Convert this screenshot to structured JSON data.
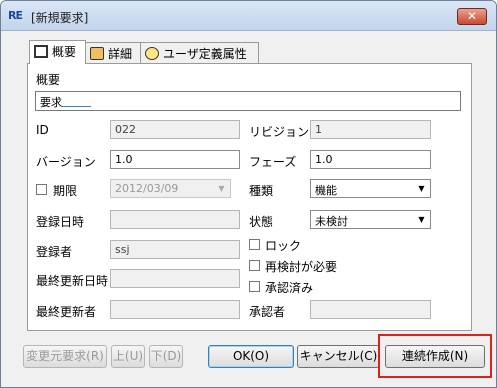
{
  "window": {
    "app_icon_text": "RE",
    "title": "[新規要求]",
    "close_glyph": "✕"
  },
  "tabs": [
    {
      "label": "概要",
      "icon": "summary-icon"
    },
    {
      "label": "詳細",
      "icon": "detail-icon"
    },
    {
      "label": "ユーザ定義属性",
      "icon": "settings-icon"
    }
  ],
  "form": {
    "summary_label": "概要",
    "summary_value": "要求",
    "id_label": "ID",
    "id_value": "022",
    "revision_label": "リビジョン",
    "revision_value": "1",
    "version_label": "バージョン",
    "version_value": "1.0",
    "phase_label": "フェーズ",
    "phase_value": "1.0",
    "deadline_label": "期限",
    "deadline_value": "2012/03/09",
    "type_label": "種類",
    "type_value": "機能",
    "created_label": "登録日時",
    "created_value": "",
    "status_label": "状態",
    "status_value": "未検討",
    "registrant_label": "登録者",
    "registrant_value": "ssj",
    "lock_label": "ロック",
    "recheck_label": "再検討が必要",
    "approved_label": "承認済み",
    "updated_label": "最終更新日時",
    "updated_value": "",
    "updater_label": "最終更新者",
    "updater_value": "",
    "approver_label": "承認者",
    "approver_value": ""
  },
  "buttons": {
    "source_req": "変更元要求(R)",
    "up": "上(U)",
    "down": "下(D)",
    "ok": "OK(O)",
    "cancel": "キャンセル(C)",
    "continuous": "連続作成(N)"
  },
  "colors": {
    "highlight": "#e0201a",
    "titlebar": "#c3d5ec"
  }
}
